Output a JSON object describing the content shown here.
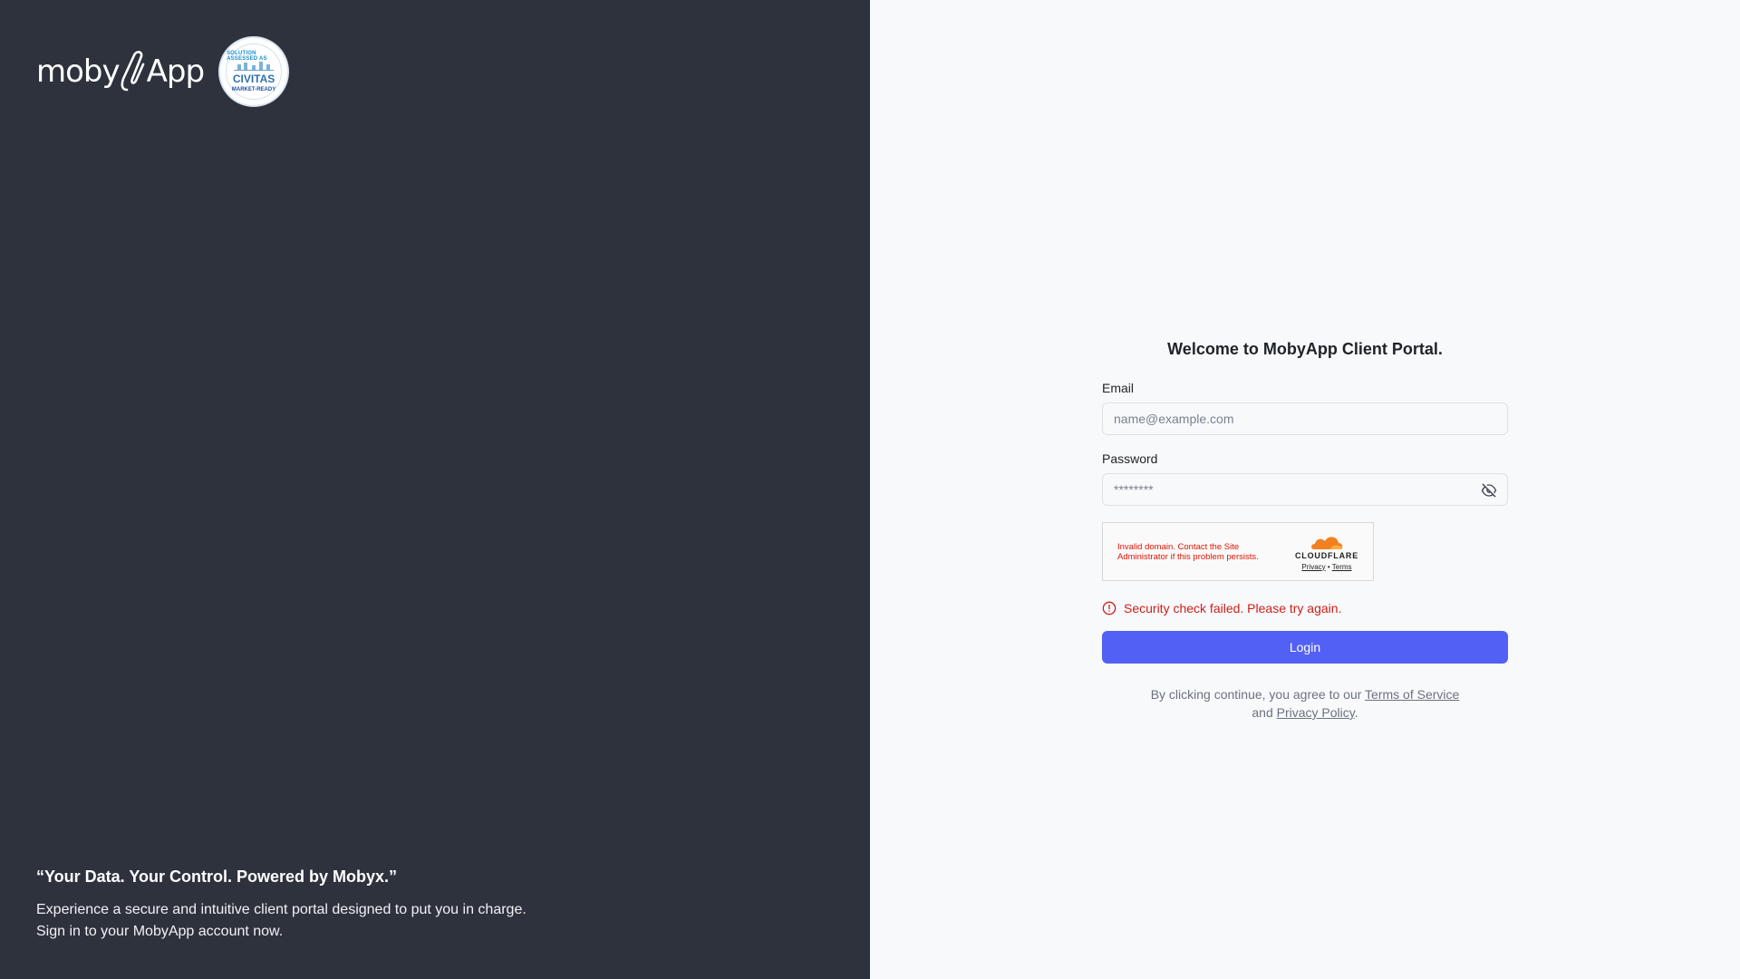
{
  "brand": {
    "logo_text_left": "moby",
    "logo_text_right": "App",
    "badge": {
      "top": "SOLUTION ASSESSED AS",
      "middle": "CIVITAS",
      "bottom": "MARKET-READY"
    }
  },
  "left_panel": {
    "quote": "“Your Data. Your Control. Powered by Mobyx.”",
    "description_line1": "Experience a secure and intuitive client portal designed to put you in charge.",
    "description_line2": "Sign in to your MobyApp account now."
  },
  "form": {
    "title": "Welcome to MobyApp Client Portal.",
    "email_label": "Email",
    "email_placeholder": "name@example.com",
    "password_label": "Password",
    "password_placeholder": "********"
  },
  "captcha": {
    "message": "Invalid domain. Contact the Site Administrator if this problem persists.",
    "provider": "CLOUDFLARE",
    "privacy": "Privacy",
    "separator": "•",
    "terms": "Terms"
  },
  "error": {
    "message": "Security check failed. Please try again."
  },
  "login_label": "Login",
  "legal": {
    "prefix": "By clicking continue, you agree to our",
    "terms_link": "Terms of Service",
    "middle": "and",
    "privacy_link": "Privacy Policy",
    "suffix": "."
  },
  "colors": {
    "left_bg": "#2d323d",
    "right_bg": "#f8f9fa",
    "primary": "#5360f5",
    "error": "#cc1f1a",
    "captcha_error": "#de1303",
    "cloudflare_orange": "#f38020"
  }
}
